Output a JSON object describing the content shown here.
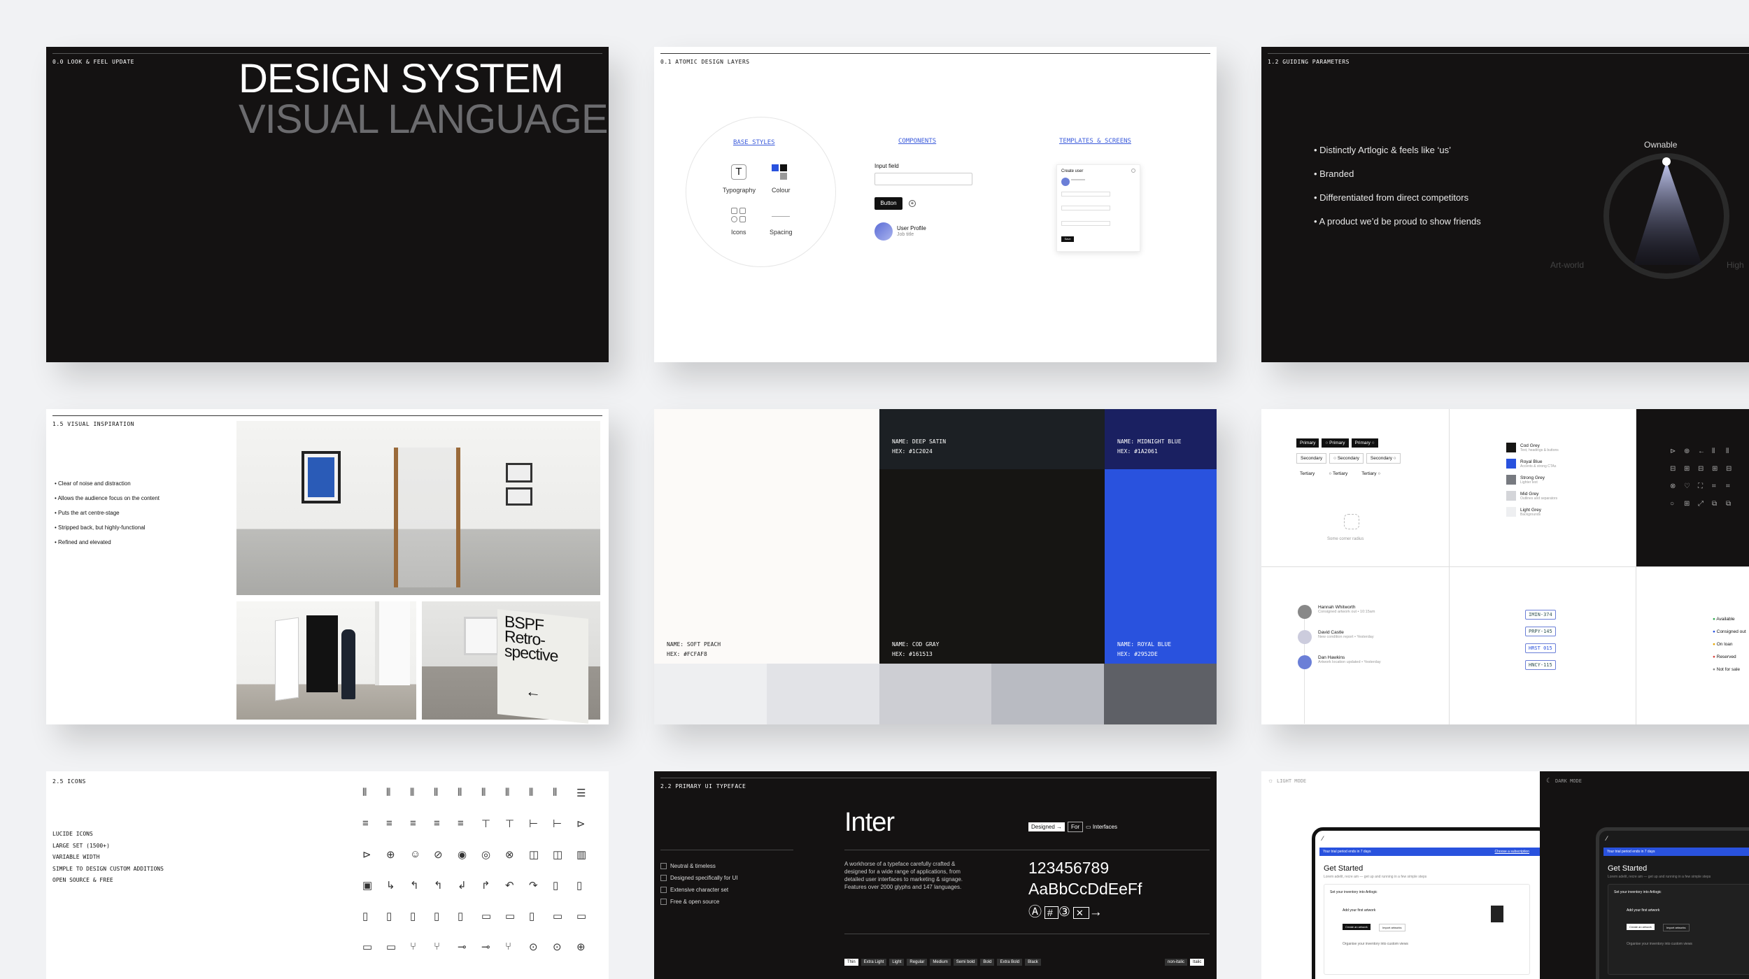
{
  "c1": {
    "tag": "0.0 LOOK & FEEL UPDATE",
    "title1": "DESIGN SYSTEM",
    "title2": "VISUAL LANGUAGE"
  },
  "c2": {
    "tag": "0.1 ATOMIC DESIGN LAYERS",
    "base": "BASE STYLES",
    "components": "COMPONENTS",
    "templates": "TEMPLATES & SCREENS",
    "typography": "Typography",
    "colour": "Colour",
    "icons": "Icons",
    "spacing": "Spacing",
    "input_label": "Input field",
    "button": "Button",
    "profile_name": "User Profile",
    "profile_role": "Job title",
    "screen_title": "Create user",
    "screen_btn": "Save"
  },
  "c3": {
    "tag": "1.2 GUIDING PARAMETERS",
    "bullets": [
      "Distinctly Artlogic & feels like ‘us’",
      "Branded",
      "Differentiated from direct competitors",
      "A product we’d be proud to show friends"
    ],
    "ownable": "Ownable",
    "artworld": "Art-world",
    "high": "High"
  },
  "c4": {
    "tag": "1.5 VISUAL INSPIRATION",
    "bullets": [
      "Clear of noise and distraction",
      "Allows the audience focus on the content",
      "Puts the art centre-stage",
      "Stripped back, but highly-functional",
      "Refined and elevated"
    ],
    "poster": "BSPF Retro- spective"
  },
  "c5": {
    "swatches": [
      {
        "name": "NAME: SOFT PEACH",
        "hex": "HEX: #FCFAF8",
        "color": "#fcfaf8",
        "ink": "#222"
      },
      {
        "name": "NAME: DEEP SATIN",
        "hex": "HEX: #1C2024",
        "color": "#1c2024",
        "ink": "#fff"
      },
      {
        "name": "NAME: MIDNIGHT BLUE",
        "hex": "HEX: #1A2061",
        "color": "#1a2061",
        "ink": "#fff"
      },
      {
        "name": "NAME: COD GRAY",
        "hex": "HEX: #161513",
        "color": "#161513",
        "ink": "#fff"
      },
      {
        "name": "NAME: ROYAL BLUE",
        "hex": "HEX: #2952DE",
        "color": "#2952de",
        "ink": "#fff"
      }
    ],
    "greys": [
      "#eeeff1",
      "#e2e3e7",
      "#cdced3",
      "#b9bbc2",
      "#5e6066"
    ]
  },
  "c6": {
    "primary": "Primary",
    "secondary": "Secondary",
    "tertiary": "Tertiary",
    "corner": "Some corner radius",
    "colors": [
      {
        "n": "Cod Grey",
        "d": "Text, headings & buttons",
        "c": "#161513"
      },
      {
        "n": "Royal Blue",
        "d": "Accents & strong CTAs",
        "c": "#2952de"
      },
      {
        "n": "Strong Grey",
        "d": "Lighter text",
        "c": "#777a80"
      },
      {
        "n": "Mid Grey",
        "d": "Outlines and separators",
        "c": "#d4d5d9"
      },
      {
        "n": "Light Grey",
        "d": "Backgrounds",
        "c": "#eeeff1"
      }
    ],
    "people": [
      {
        "n": "Hannah Whitworth",
        "d": "Consigned artwork out • 10:15am"
      },
      {
        "n": "David Castle",
        "d": "New condition report • Yesterday"
      },
      {
        "n": "Dan Hawkins",
        "d": "Artwork location updated • Yesterday"
      }
    ],
    "codes": [
      "IMIN-374",
      "PRPY-145",
      "HRST 015",
      "HNCY-115"
    ],
    "statuses": [
      "Available",
      "Consigned out",
      "On loan",
      "Reserved",
      "Not for sale"
    ]
  },
  "c7": {
    "tag": "2.5 ICONS",
    "lines": [
      "LUCIDE ICONS",
      "LARGE SET (1500+)",
      "VARIABLE WIDTH",
      "SIMPLE TO DESIGN CUSTOM ADDITIONS",
      "OPEN SOURCE & FREE"
    ]
  },
  "c8": {
    "tag": "2.2 PRIMARY UI TYPEFACE",
    "name": "Inter",
    "chip1": "Designed →",
    "chip2": "For",
    "chip3": "Interfaces",
    "features": [
      "Neutral & timeless",
      "Designed specifically for UI",
      "Extensive character set",
      "Free & open source"
    ],
    "desc": "A workhorse of a typeface carefully crafted & designed for a wide range of applications, from detailed user interfaces to marketing & signage. Features over 2000 glyphs and 147 languages.",
    "digits": "123456789",
    "letters": "AaBbCcDdEeFf",
    "weights": [
      "Thin",
      "Extra Light",
      "Light",
      "Regular",
      "Medium",
      "Semi bold",
      "Bold",
      "Extra Bold",
      "Black"
    ],
    "nontab": "non-italic",
    "italic": "Italic"
  },
  "c9": {
    "light": "LIGHT MODE",
    "dark": "DARK MODE",
    "banner": "Your trial period ends in 7 days",
    "banner_link": "Choose a subscription",
    "get_started": "Get Started",
    "sub": "Lorem adelit, recre am — get up and running in a few simple steps",
    "step": "Set your inventory into Artlogic",
    "add": "Add your first artwork",
    "btn1": "Create an artwork",
    "btn2": "Import artworks",
    "contacts": "Organise your inventory into custom views"
  }
}
